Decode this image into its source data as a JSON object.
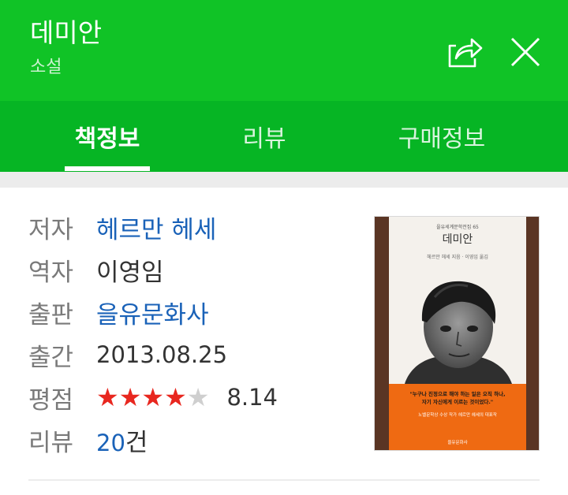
{
  "header": {
    "title": "데미안",
    "subtitle": "소설",
    "share_icon": "share-icon",
    "close_icon": "close-icon"
  },
  "tabs": [
    {
      "label": "책정보",
      "active": true
    },
    {
      "label": "리뷰",
      "active": false
    },
    {
      "label": "구매정보",
      "active": false
    }
  ],
  "info": {
    "author_label": "저자",
    "author": "헤르만 헤세",
    "translator_label": "역자",
    "translator": "이영임",
    "publisher_label": "출판",
    "publisher": "을유문화사",
    "date_label": "출간",
    "date": "2013.08.25",
    "rating_label": "평점",
    "rating": "8.14",
    "rating_stars": 4,
    "rating_max": 5,
    "review_label": "리뷰",
    "review_count": "20",
    "review_unit": "건"
  },
  "cover": {
    "series": "을유세계문학전집 65",
    "title": "데미안",
    "subtitle": "헤르만 헤세 지음 · 이영임 옮김",
    "quote": "\"누구나 진정으로 해야 하는 일은 오직 하나,\n자기 자신에게 이르는 것이었다.\"",
    "blurb": "노벨문학상 수상 작가 헤르만 헤세의 대표작",
    "publisher": "을유문화사"
  },
  "colors": {
    "header_green": "#10c326",
    "tab_green": "#06b524",
    "link_blue": "#1a62b8",
    "star_red": "#e8271f"
  }
}
